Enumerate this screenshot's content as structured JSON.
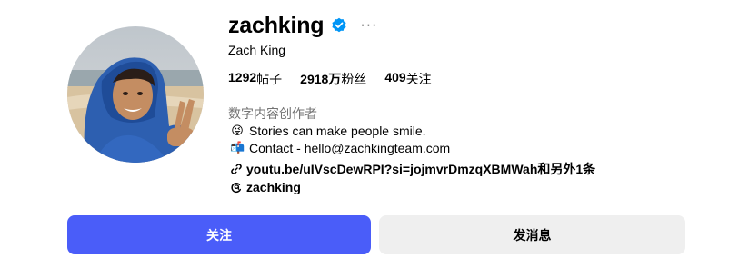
{
  "profile": {
    "username": "zachking",
    "full_name": "Zach King",
    "stats": [
      {
        "value": "1292",
        "label": "帖子"
      },
      {
        "value": "2918万",
        "label": "粉丝"
      },
      {
        "value": "409",
        "label": "关注"
      }
    ],
    "category": "数字内容创作者",
    "bio": [
      {
        "emoji": "😜",
        "text": "Stories can make people smile."
      },
      {
        "emoji": "📬",
        "text": "Contact - hello@zachkingteam.com"
      }
    ],
    "link": "youtu.be/uIVscDewRPI?si=jojmvrDmzqXBMWah和另外1条",
    "threads_handle": "zachking",
    "more_label": "···"
  },
  "actions": {
    "follow_label": "关注",
    "message_label": "发消息"
  },
  "colors": {
    "accent": "#4a5df9",
    "verified": "#0095f6",
    "secondary_text": "#737373",
    "message_button_bg": "#efefef"
  },
  "icons": {
    "verified": "verified-badge-icon",
    "more": "more-options-icon",
    "link": "link-icon",
    "threads": "threads-icon"
  }
}
